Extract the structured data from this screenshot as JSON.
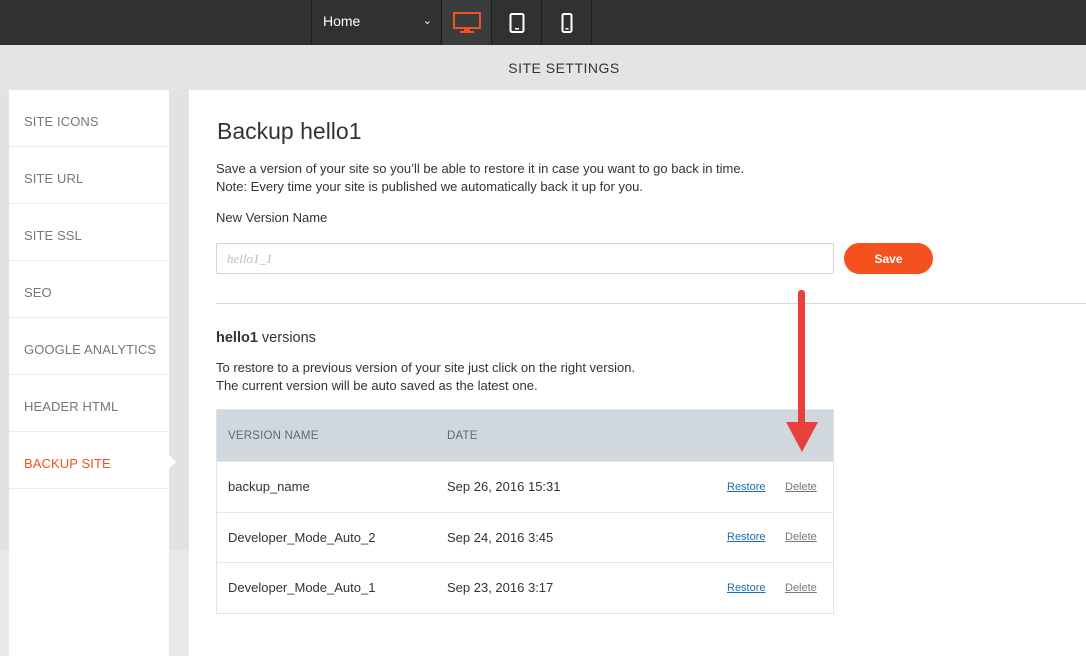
{
  "toolbar": {
    "page_select": "Home",
    "devices": [
      "desktop-icon",
      "tablet-icon",
      "mobile-icon"
    ],
    "active_device": "desktop"
  },
  "modal": {
    "title": "SITE SETTINGS"
  },
  "sidebar": {
    "items": [
      {
        "label": "SITE ICONS"
      },
      {
        "label": "SITE URL"
      },
      {
        "label": "SITE SSL"
      },
      {
        "label": "SEO"
      },
      {
        "label": "GOOGLE ANALYTICS"
      },
      {
        "label": "HEADER HTML"
      },
      {
        "label": "BACKUP SITE"
      }
    ],
    "active": "BACKUP SITE"
  },
  "main": {
    "heading": "Backup hello1",
    "desc_line1": "Save a version of your site so you’ll be able to restore it in case you want to go back in time.",
    "desc_line2": "Note: Every time your site is published we automatically back it up for you.",
    "field_label": "New Version Name",
    "input_placeholder": "hello1_1",
    "save_label": "Save",
    "versions_site": "hello1",
    "versions_suffix": " versions",
    "restore_line1": "To restore to a previous version of your site just click on the right version.",
    "restore_line2": "The current version will be auto saved as the latest one."
  },
  "table": {
    "headers": [
      "VERSION NAME",
      "DATE"
    ],
    "rows": [
      {
        "name": "backup_name",
        "date": "Sep 26, 2016 15:31",
        "restore": "Restore",
        "delete": "Delete"
      },
      {
        "name": "Developer_Mode_Auto_2",
        "date": "Sep 24, 2016 3:45",
        "restore": "Restore",
        "delete": "Delete"
      },
      {
        "name": "Developer_Mode_Auto_1",
        "date": "Sep 23, 2016 3:17",
        "restore": "Restore",
        "delete": "Delete"
      }
    ]
  },
  "colors": {
    "accent": "#f4511e",
    "toolbar": "#2f3133",
    "table_header": "#d0d8de",
    "link": "#1a6fb2",
    "annotation_arrow": "#e8413c"
  }
}
